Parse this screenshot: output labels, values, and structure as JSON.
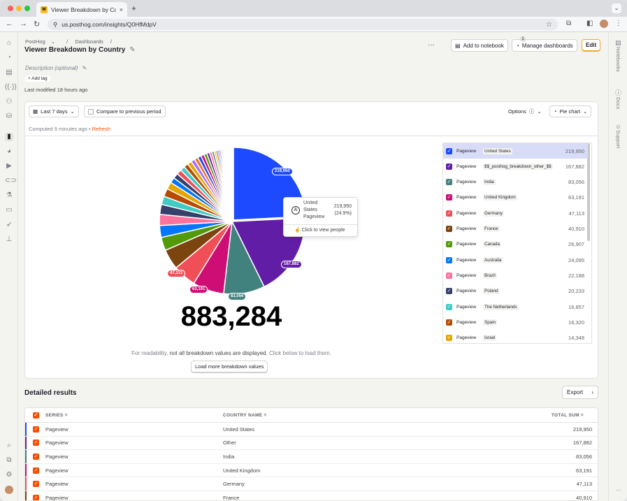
{
  "browser": {
    "tab_title": "Viewer Breakdown by Country",
    "favicon_text": "W",
    "url": "us.posthog.com/insights/Q0HfMdpV"
  },
  "header": {
    "breadcrumb": [
      "PostHog",
      "Dashboards"
    ],
    "title": "Viewer Breakdown by Country",
    "add_to_notebook": "Add to notebook",
    "manage_dashboards": "Manage dashboards",
    "manage_dashboards_badge": "1",
    "edit": "Edit",
    "description_placeholder": "Description (optional)",
    "add_tag": "Add tag",
    "last_modified": "Last modified 18 hours ago"
  },
  "controls": {
    "date_range": "Last 7 days",
    "compare_label": "Compare to previous period",
    "options_label": "Options",
    "chart_type": "Pie chart",
    "computed": "Computed 9 minutes ago",
    "refresh": "Refresh"
  },
  "total": "883,284",
  "note": {
    "pre": "For readability,",
    "bold": "not all breakdown values are displayed.",
    "post": "Click below to load them."
  },
  "load_more": "Load more breakdown values",
  "tooltip": {
    "line1": "United",
    "line2": "States",
    "line3": "Pageview",
    "value": "219,950",
    "pct": "(24.9%)",
    "action": "Click to view people",
    "avatar_letter": "A"
  },
  "slice_labels": {
    "us": "219,950",
    "other": "167,882",
    "india": "83,056",
    "uk": "63,191",
    "germany": "47,113"
  },
  "chart_data": {
    "type": "pie",
    "series_name": "Pageview",
    "categories": [
      "United States",
      "$$_posthog_breakdown_other_$$",
      "India",
      "United Kingdom",
      "Germany",
      "France",
      "Canada",
      "Australia",
      "Brazil",
      "Poland",
      "The Netherlands",
      "Spain",
      "Israel"
    ],
    "values": [
      219950,
      167882,
      83056,
      63191,
      47113,
      40910,
      26907,
      24095,
      22188,
      20233,
      16857,
      16320,
      14348
    ],
    "colors": [
      "#1d4aff",
      "#621da6",
      "#42827e",
      "#ce0e74",
      "#f14f58",
      "#7c440e",
      "#529a0a",
      "#0476fb",
      "#fe729e",
      "#35416b",
      "#41cbc4",
      "#b64b02",
      "#e4a604"
    ],
    "total": 883284,
    "extra_slices": {
      "values": [
        11000,
        10500,
        10000,
        9500,
        9000,
        8500,
        8000,
        7500,
        7000,
        6500,
        6000,
        5500,
        5000,
        4500,
        4000,
        3500,
        3200,
        2900,
        2600,
        2400,
        2200,
        2000,
        1800,
        1600,
        1500,
        1300,
        1200,
        1100,
        1000,
        900,
        800,
        700,
        600,
        500,
        400,
        309
      ],
      "colors": [
        "#0476fb",
        "#35416b",
        "#f14f58",
        "#41cbc4",
        "#b64b02",
        "#e4a604",
        "#a56eff",
        "#ec7c29",
        "#1d4aff",
        "#ce0e74",
        "#529a0a",
        "#621da6",
        "#fe729e",
        "#42827e",
        "#f9bd2b",
        "#7c440e",
        "#0476fb",
        "#ce0e74",
        "#41cbc4",
        "#35416b",
        "#a56eff",
        "#1d4aff",
        "#e4a604",
        "#f14f58",
        "#529a0a",
        "#621da6",
        "#fe729e",
        "#b64b02",
        "#42827e",
        "#0476fb",
        "#ec7c29",
        "#ce0e74",
        "#41cbc4",
        "#a56eff",
        "#e4a604",
        "#35416b"
      ]
    }
  },
  "legend": {
    "rows": [
      {
        "series": "Pageview",
        "country": "United States",
        "value": "219,950"
      },
      {
        "series": "Pageview",
        "country": "$$_posthog_breakdown_other_$$",
        "value": "167,882"
      },
      {
        "series": "Pageview",
        "country": "India",
        "value": "83,056"
      },
      {
        "series": "Pageview",
        "country": "United Kingdom",
        "value": "63,191"
      },
      {
        "series": "Pageview",
        "country": "Germany",
        "value": "47,113"
      },
      {
        "series": "Pageview",
        "country": "France",
        "value": "40,910"
      },
      {
        "series": "Pageview",
        "country": "Canada",
        "value": "26,907"
      },
      {
        "series": "Pageview",
        "country": "Australia",
        "value": "24,095"
      },
      {
        "series": "Pageview",
        "country": "Brazil",
        "value": "22,188"
      },
      {
        "series": "Pageview",
        "country": "Poland",
        "value": "20,233"
      },
      {
        "series": "Pageview",
        "country": "The Netherlands",
        "value": "16,857"
      },
      {
        "series": "Pageview",
        "country": "Spain",
        "value": "16,320"
      },
      {
        "series": "Pageview",
        "country": "Israel",
        "value": "14,348"
      }
    ]
  },
  "results": {
    "title": "Detailed results",
    "export": "Export",
    "columns": [
      "SERIES",
      "COUNTRY NAME",
      "TOTAL SUM"
    ],
    "rows": [
      {
        "series": "Pageview",
        "country": "United States",
        "sum": "219,950",
        "color": "#1d4aff"
      },
      {
        "series": "Pageview",
        "country": "Other",
        "sum": "167,882",
        "color": "#621da6"
      },
      {
        "series": "Pageview",
        "country": "India",
        "sum": "83,056",
        "color": "#42827e"
      },
      {
        "series": "Pageview",
        "country": "United Kingdom",
        "sum": "63,191",
        "color": "#ce0e74"
      },
      {
        "series": "Pageview",
        "country": "Germany",
        "sum": "47,113",
        "color": "#f14f58"
      },
      {
        "series": "Pageview",
        "country": "France",
        "sum": "40,910",
        "color": "#7c440e"
      }
    ]
  },
  "right_sidebar": [
    "Notebooks",
    "Docs",
    "Support"
  ]
}
